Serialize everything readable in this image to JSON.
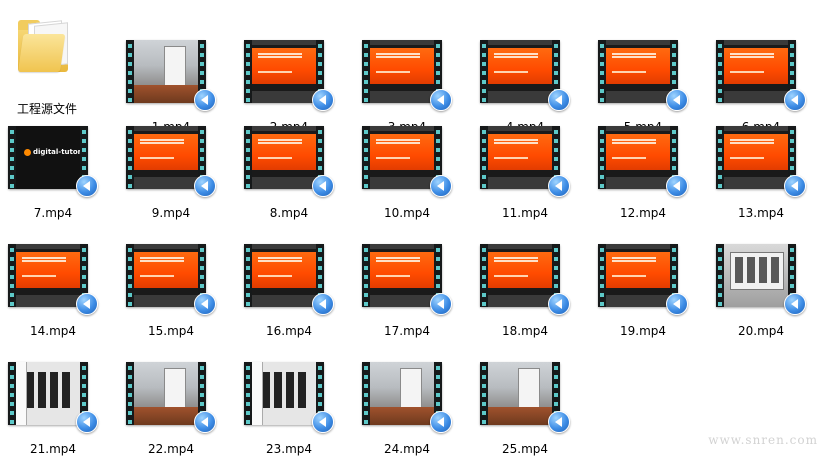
{
  "folder": {
    "label": "工程源文件",
    "icon": "folder-icon"
  },
  "videos": [
    {
      "label": "1.mp4",
      "thumb": "shot"
    },
    {
      "label": "2.mp4",
      "thumb": "orange"
    },
    {
      "label": "3.mp4",
      "thumb": "orange"
    },
    {
      "label": "4.mp4",
      "thumb": "orange"
    },
    {
      "label": "5.mp4",
      "thumb": "orange"
    },
    {
      "label": "6.mp4",
      "thumb": "orange"
    },
    {
      "label": "7.mp4",
      "thumb": "dark",
      "logo_text": "digital-tutors"
    },
    {
      "label": "9.mp4",
      "thumb": "orange"
    },
    {
      "label": "8.mp4",
      "thumb": "orange"
    },
    {
      "label": "10.mp4",
      "thumb": "orange"
    },
    {
      "label": "11.mp4",
      "thumb": "orange"
    },
    {
      "label": "12.mp4",
      "thumb": "orange"
    },
    {
      "label": "13.mp4",
      "thumb": "orange"
    },
    {
      "label": "14.mp4",
      "thumb": "orange"
    },
    {
      "label": "15.mp4",
      "thumb": "orange"
    },
    {
      "label": "16.mp4",
      "thumb": "orange"
    },
    {
      "label": "17.mp4",
      "thumb": "orange"
    },
    {
      "label": "18.mp4",
      "thumb": "orange"
    },
    {
      "label": "19.mp4",
      "thumb": "orange"
    },
    {
      "label": "20.mp4",
      "thumb": "grey"
    },
    {
      "label": "21.mp4",
      "thumb": "thumbs"
    },
    {
      "label": "22.mp4",
      "thumb": "shot"
    },
    {
      "label": "23.mp4",
      "thumb": "thumbs"
    },
    {
      "label": "24.mp4",
      "thumb": "shot"
    },
    {
      "label": "25.mp4",
      "thumb": "shot"
    }
  ],
  "badge_icon": "play-badge-icon",
  "watermark": "www.snren.com"
}
